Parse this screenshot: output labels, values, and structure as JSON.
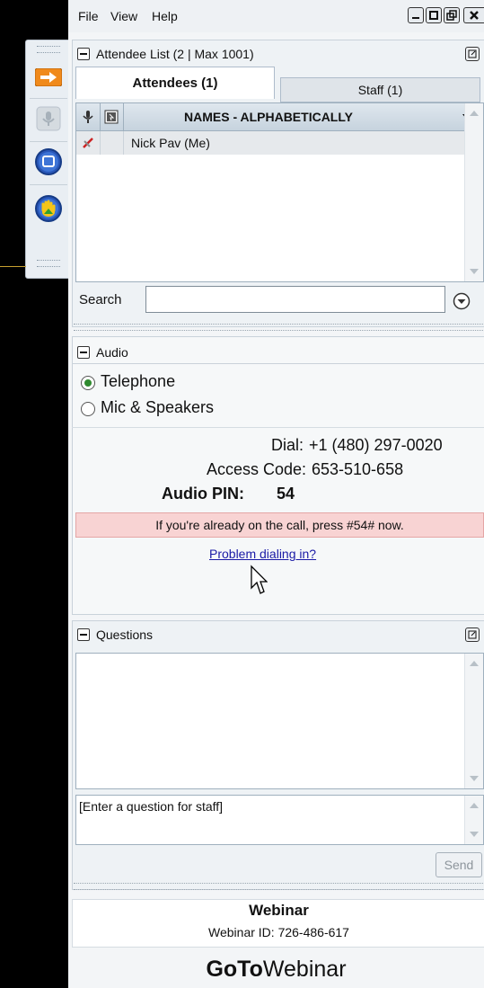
{
  "menu": {
    "file": "File",
    "view": "View",
    "help": "Help"
  },
  "attendee_panel": {
    "title": "Attendee List  (2 | Max 1001)",
    "tabs": [
      {
        "label": "Attendees (1)",
        "active": true
      },
      {
        "label": "Staff (1)",
        "active": false
      }
    ],
    "column_header": "NAMES - ALPHABETICALLY",
    "rows": [
      {
        "name": "Nick Pav (Me)"
      }
    ],
    "search_label": "Search",
    "search_value": ""
  },
  "audio_panel": {
    "title": "Audio",
    "options": [
      {
        "label": "Telephone",
        "selected": true
      },
      {
        "label": "Mic & Speakers",
        "selected": false
      }
    ],
    "dial_label": "Dial:",
    "dial_value": "+1 (480) 297-0020",
    "access_label": "Access Code:",
    "access_value": "653-510-658",
    "pin_label": "Audio PIN:",
    "pin_value": "54",
    "notice": "If you're already on the call, press #54# now.",
    "help_link": "Problem dialing in?"
  },
  "questions_panel": {
    "title": "Questions",
    "input_placeholder": "[Enter a question for staff]",
    "send_label": "Send"
  },
  "footer": {
    "webinar_title": "Webinar",
    "webinar_id": "Webinar ID: 726-486-617",
    "brand_bold": "GoTo",
    "brand_light": "Webinar"
  },
  "colors": {
    "notice_bg": "#f8d3d3",
    "link": "#1a1aa6",
    "accent_orange": "#f08a1c",
    "button_blue": "#2856b8"
  }
}
